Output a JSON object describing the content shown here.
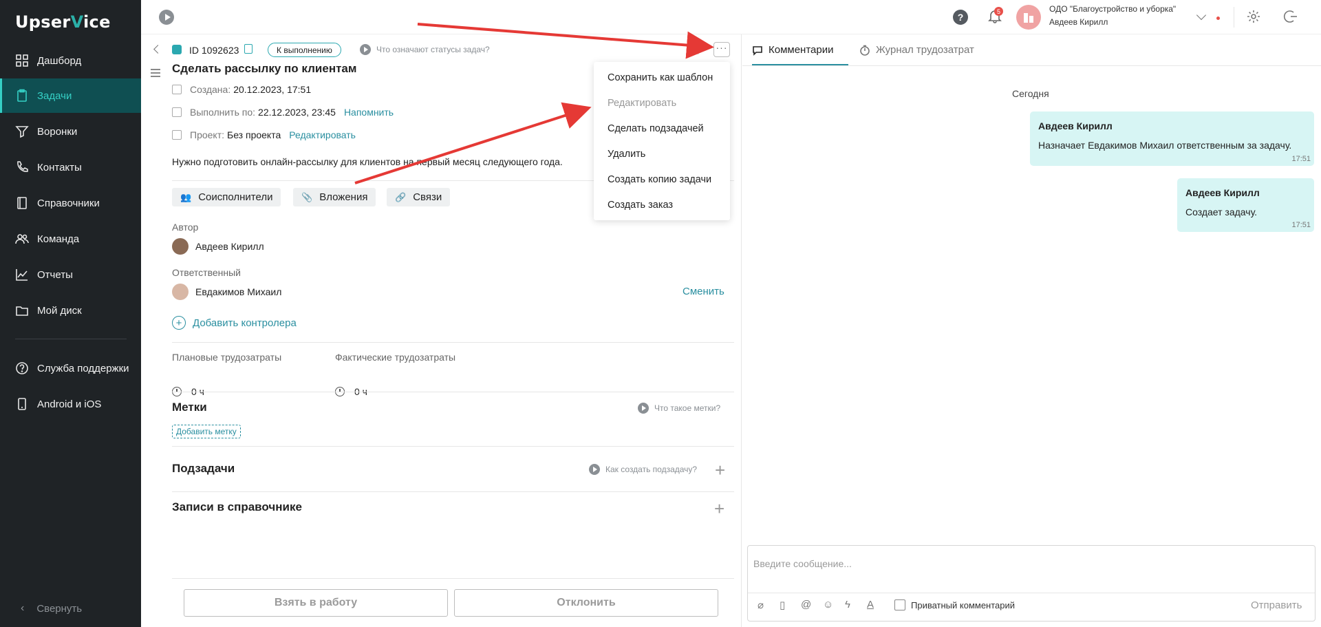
{
  "sidebar": {
    "logo_prefix": "Upser",
    "logo_accent": "V",
    "logo_suffix": "ice",
    "items": [
      {
        "label": "Дашборд",
        "icon": "grid-icon"
      },
      {
        "label": "Задачи",
        "icon": "clipboard-icon",
        "active": true
      },
      {
        "label": "Воронки",
        "icon": "funnel-icon"
      },
      {
        "label": "Контакты",
        "icon": "phone-icon"
      },
      {
        "label": "Справочники",
        "icon": "book-icon"
      },
      {
        "label": "Команда",
        "icon": "team-icon"
      },
      {
        "label": "Отчеты",
        "icon": "chart-icon"
      },
      {
        "label": "Мой диск",
        "icon": "folder-icon"
      },
      {
        "label": "Служба поддержки",
        "icon": "help-circle-icon"
      },
      {
        "label": "Android и iOS",
        "icon": "mobile-icon"
      }
    ],
    "collapse_label": "Свернуть"
  },
  "topbar": {
    "help_label": "?",
    "notifications_count": "5",
    "org_name": "ОДО \"Благоустройство и уборка\"",
    "user_name": "Авдеев Кирилл"
  },
  "task": {
    "id_label": "ID 1092623",
    "status": "К выполнению",
    "status_help": "Что означают статусы задач?",
    "title": "Сделать рассылку по клиентам",
    "created_label": "Создана:",
    "created_value": "20.12.2023, 17:51",
    "due_label": "Выполнить по:",
    "due_value": "22.12.2023, 23:45",
    "remind_link": "Напомнить",
    "project_label": "Проект:",
    "project_value": "Без проекта",
    "project_edit_link": "Редактировать",
    "description": "Нужно подготовить онлайн-рассылку для клиентов на первый месяц следующего года.",
    "chips": [
      "Соисполнители",
      "Вложения",
      "Связи"
    ],
    "author_label": "Автор",
    "author_name": "Авдеев Кирилл",
    "assignee_label": "Ответственный",
    "assignee_name": "Евдакимов Михаил",
    "change_link": "Сменить",
    "add_controller": "Добавить контролера",
    "planned_label": "Плановые трудозатраты",
    "planned_value": "0 ч",
    "actual_label": "Фактические трудозатраты",
    "actual_value": "0 ч",
    "tags_title": "Метки",
    "tags_help": "Что такое метки?",
    "add_tag": "Добавить метку",
    "subtasks_title": "Подзадачи",
    "subtasks_help": "Как создать подзадачу?",
    "directory_title": "Записи в справочнике",
    "take_button": "Взять в работу",
    "reject_button": "Отклонить"
  },
  "menu": {
    "items": [
      {
        "label": "Сохранить как шаблон",
        "disabled": false
      },
      {
        "label": "Редактировать",
        "disabled": true
      },
      {
        "label": "Сделать подзадачей",
        "disabled": false
      },
      {
        "label": "Удалить",
        "disabled": false
      },
      {
        "label": "Создать копию задачи",
        "disabled": false
      },
      {
        "label": "Создать заказ",
        "disabled": false
      }
    ]
  },
  "comments": {
    "tabs": [
      "Комментарии",
      "Журнал трудозатрат"
    ],
    "today": "Сегодня",
    "messages": [
      {
        "author": "Авдеев Кирилл",
        "text": "Назначает Евдакимов Михаил ответственным за задачу.",
        "time": "17:51"
      },
      {
        "author": "Авдеев Кирилл",
        "text": "Создает задачу.",
        "time": "17:51"
      }
    ],
    "input_placeholder": "Введите сообщение...",
    "private_label": "Приватный комментарий",
    "send_label": "Отправить"
  },
  "colors": {
    "accent": "#2a8fa0",
    "sidebar_bg": "#1f2326",
    "active_item_bg": "#0f4f52",
    "bubble_bg": "#d7f5f4",
    "annotation_arrow": "#e53935"
  }
}
